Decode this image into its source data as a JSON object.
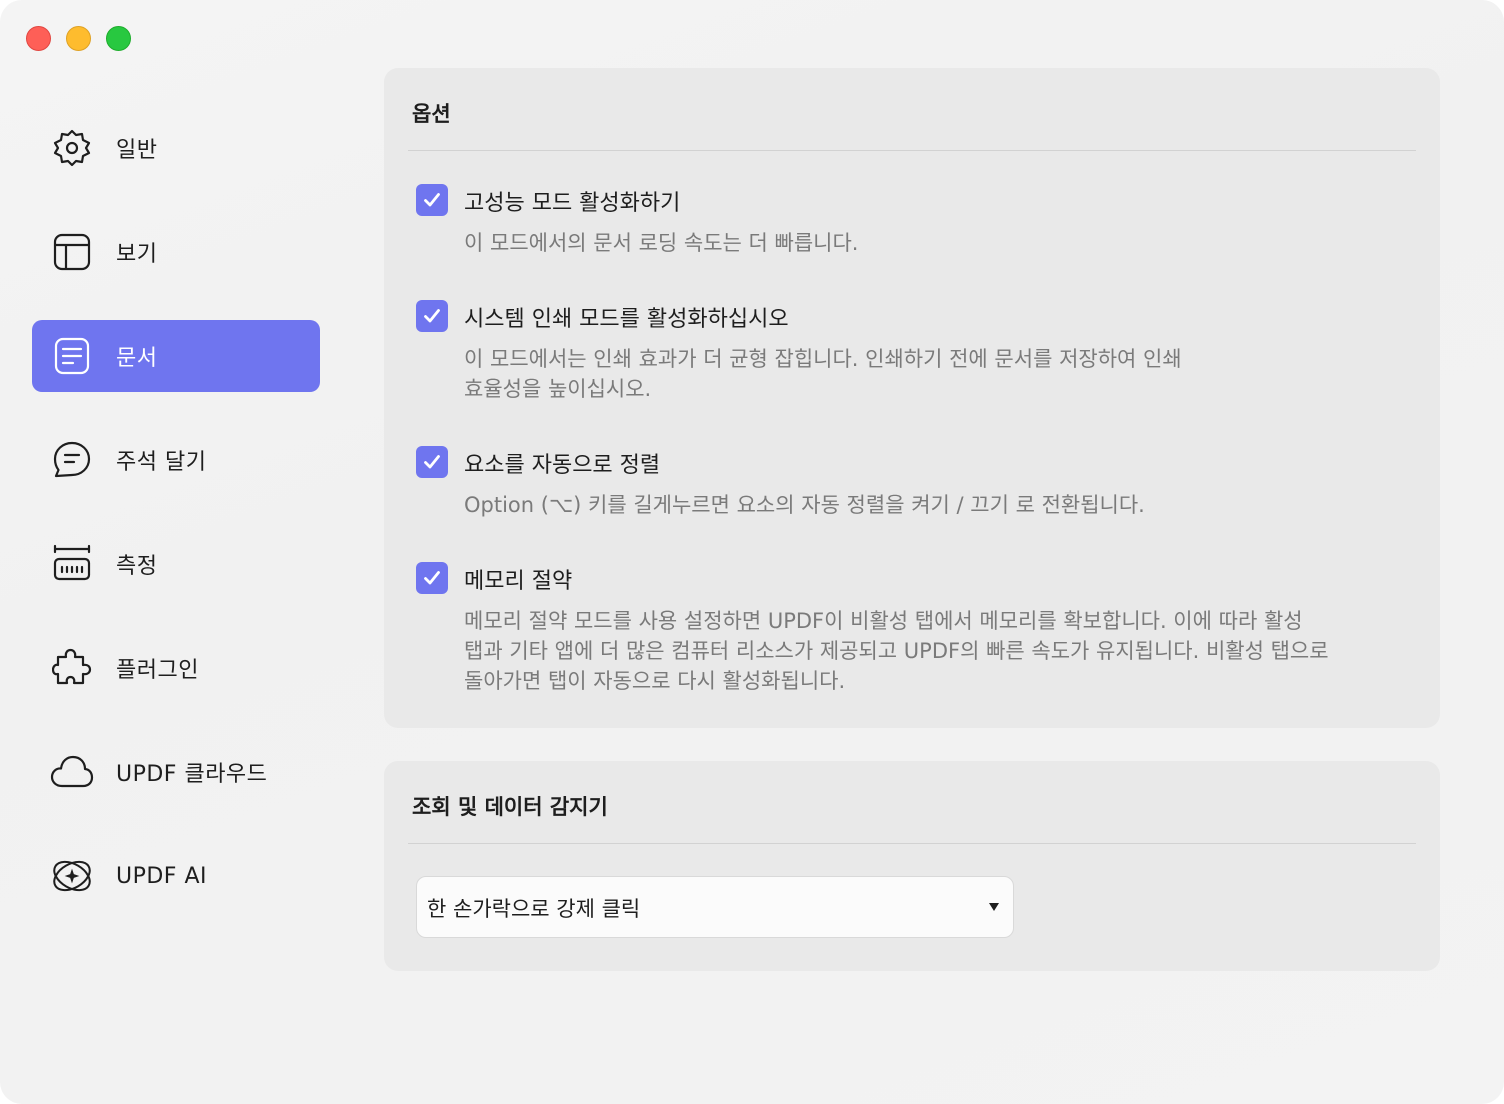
{
  "window": {
    "controls": [
      "close",
      "minimize",
      "maximize"
    ]
  },
  "sidebar": {
    "items": [
      {
        "label": "일반",
        "icon": "gear-icon",
        "active": false
      },
      {
        "label": "보기",
        "icon": "layout-icon",
        "active": false
      },
      {
        "label": "문서",
        "icon": "document-icon",
        "active": true
      },
      {
        "label": "주석 달기",
        "icon": "comment-icon",
        "active": false
      },
      {
        "label": "측정",
        "icon": "ruler-icon",
        "active": false
      },
      {
        "label": "플러그인",
        "icon": "puzzle-icon",
        "active": false
      },
      {
        "label": "UPDF 클라우드",
        "icon": "cloud-icon",
        "active": false
      },
      {
        "label": "UPDF AI",
        "icon": "ai-sparkle-icon",
        "active": false
      }
    ]
  },
  "options_panel": {
    "title": "옵션",
    "options": [
      {
        "label": "고성능 모드 활성화하기",
        "checked": true,
        "description_lines": [
          "이 모드에서의 문서 로딩 속도는 더 빠릅니다."
        ]
      },
      {
        "label": "시스템 인쇄 모드를 활성화하십시오",
        "checked": true,
        "description_lines": [
          "이 모드에서는 인쇄 효과가 더 균형 잡힙니다. 인쇄하기 전에 문서를 저장하여 인쇄",
          "효율성을 높이십시오."
        ]
      },
      {
        "label": "요소를 자동으로 정렬",
        "checked": true,
        "description_lines": [
          "Option (⌥) 키를 길게누르면 요소의 자동 정렬을 켜기 / 끄기 로 전환됩니다."
        ]
      },
      {
        "label": "메모리 절약",
        "checked": true,
        "description_lines": [
          "메모리 절약 모드를 사용 설정하면 UPDF이 비활성 탭에서 메모리를 확보합니다. 이에 따라 활성",
          "탭과 기타 앱에 더 많은 컴퓨터 리소스가 제공되고 UPDF의 빠른 속도가 유지됩니다. 비활성 탭으로",
          "돌아가면 탭이 자동으로 다시 활성화됩니다."
        ]
      }
    ]
  },
  "detector_panel": {
    "title": "조회 및 데이터 감지기",
    "select_value": "한 손가락으로 강제 클릭"
  },
  "colors": {
    "accent": "#6f75ef",
    "panel": "#e9e9e9",
    "description": "#7a7a7a"
  }
}
